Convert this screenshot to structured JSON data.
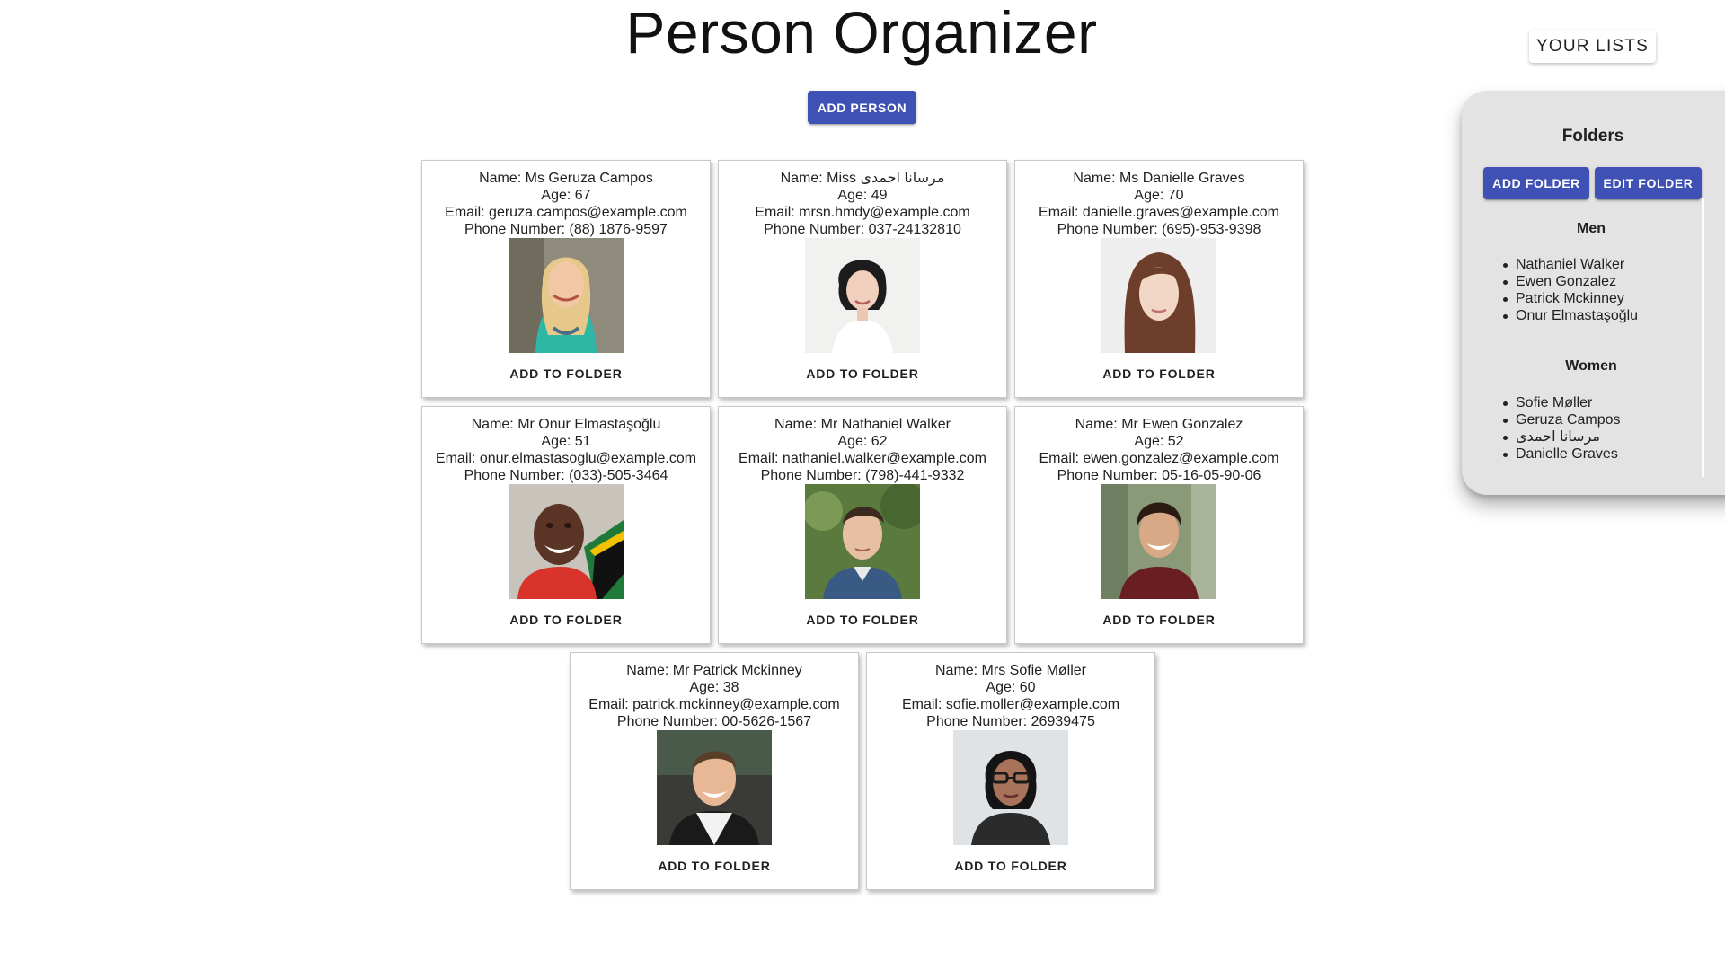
{
  "app": {
    "title": "Person Organizer",
    "add_person_label": "ADD PERSON",
    "your_lists_label": "YOUR LISTS"
  },
  "colors": {
    "primary": "#3f51b5",
    "panel_bg": "#e3e3e3"
  },
  "labels": {
    "add_to_folder": "ADD TO FOLDER"
  },
  "people": [
    {
      "name": "Name: Ms Geruza Campos",
      "age": "Age: 67",
      "email": "Email: geruza.campos@example.com",
      "phone": "Phone Number: (88) 1876-9597",
      "photo": "woman-blonde-photo"
    },
    {
      "name": "Name: Miss مرسانا احمدی",
      "age": "Age: 49",
      "email": "Email: mrsn.hmdy@example.com",
      "phone": "Phone Number: 037-24132810",
      "photo": "woman-short-dark-hair-photo"
    },
    {
      "name": "Name: Ms Danielle Graves",
      "age": "Age: 70",
      "email": "Email: danielle.graves@example.com",
      "phone": "Phone Number: (695)-953-9398",
      "photo": "woman-brown-hair-photo"
    },
    {
      "name": "Name: Mr Onur Elmastaşoğlu",
      "age": "Age: 51",
      "email": "Email: onur.elmastasoglu@example.com",
      "phone": "Phone Number: (033)-505-3464",
      "photo": "man-smiling-flag-photo"
    },
    {
      "name": "Name: Mr Nathaniel Walker",
      "age": "Age: 62",
      "email": "Email: nathaniel.walker@example.com",
      "phone": "Phone Number: (798)-441-9332",
      "photo": "man-outdoors-photo"
    },
    {
      "name": "Name: Mr Ewen Gonzalez",
      "age": "Age: 52",
      "email": "Email: ewen.gonzalez@example.com",
      "phone": "Phone Number: 05-16-05-90-06",
      "photo": "man-dark-hair-photo"
    },
    {
      "name": "Name: Mr Patrick Mckinney",
      "age": "Age: 38",
      "email": "Email: patrick.mckinney@example.com",
      "phone": "Phone Number: 00-5626-1567",
      "photo": "man-jacket-photo"
    },
    {
      "name": "Name: Mrs Sofie Møller",
      "age": "Age: 60",
      "email": "Email: sofie.moller@example.com",
      "phone": "Phone Number: 26939475",
      "photo": "woman-glasses-photo"
    }
  ],
  "folders": {
    "title": "Folders",
    "add_folder_label": "ADD FOLDER",
    "edit_folder_label": "EDIT FOLDER",
    "groups": [
      {
        "title": "Men",
        "members": [
          "Nathaniel Walker",
          "Ewen Gonzalez",
          "Patrick Mckinney",
          "Onur Elmastaşoğlu"
        ]
      },
      {
        "title": "Women",
        "members": [
          "Sofie Møller",
          "Geruza Campos",
          "مرسانا احمدی",
          "Danielle Graves"
        ]
      }
    ]
  }
}
